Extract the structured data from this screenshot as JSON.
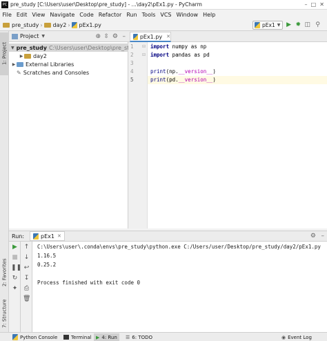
{
  "window": {
    "title": "pre_study [C:\\Users\\user\\Desktop\\pre_study] - ...\\day2\\pEx1.py - PyCharm",
    "app_icon_label": "PC"
  },
  "menu": [
    "File",
    "Edit",
    "View",
    "Navigate",
    "Code",
    "Refactor",
    "Run",
    "Tools",
    "VCS",
    "Window",
    "Help"
  ],
  "navbar": {
    "crumbs": [
      "pre_study",
      "day2",
      "pEx1.py"
    ],
    "run_config": "pEx1"
  },
  "left_stripe": {
    "project_tab": "1: Project",
    "favorites_tab": "2: Favorites",
    "structure_tab": "7: Structure"
  },
  "project_panel": {
    "header": "Project",
    "tree": [
      {
        "label": "pre_study",
        "path": "C:\\Users\\user\\Desktop\\pre_study"
      },
      {
        "label": "day2"
      },
      {
        "label": "External Libraries"
      },
      {
        "label": "Scratches and Consoles"
      }
    ]
  },
  "editor": {
    "tab": "pEx1.py",
    "line_numbers": [
      "1",
      "2",
      "3",
      "4",
      "5"
    ],
    "lines": [
      {
        "kw": "import",
        "rest": " numpy as np"
      },
      {
        "kw": "import",
        "rest": " pandas as pd"
      },
      {
        "kw": "",
        "rest": ""
      },
      {
        "fn": "print",
        "open": "(np.",
        "dunder": "__version__",
        "close": ")"
      },
      {
        "fn": "print",
        "open": "(pd.",
        "dunder": "__version__",
        "close": ")"
      }
    ]
  },
  "run_panel": {
    "label": "Run:",
    "tab": "pEx1",
    "output": [
      "C:\\Users\\user\\.conda\\envs\\pre_study\\python.exe C:/Users/user/Desktop/pre_study/day2/pEx1.py",
      "1.16.5",
      "0.25.2",
      "",
      "Process finished with exit code 0"
    ]
  },
  "status_bar": {
    "python_console": "Python Console",
    "terminal": "Terminal",
    "run": "4: Run",
    "todo": "6: TODO",
    "event_log": "Event Log"
  },
  "colors": {
    "accent": "#4a88c7",
    "keyword": "#000080",
    "dunder": "#b200b2",
    "run_green": "#3c9a3c"
  }
}
